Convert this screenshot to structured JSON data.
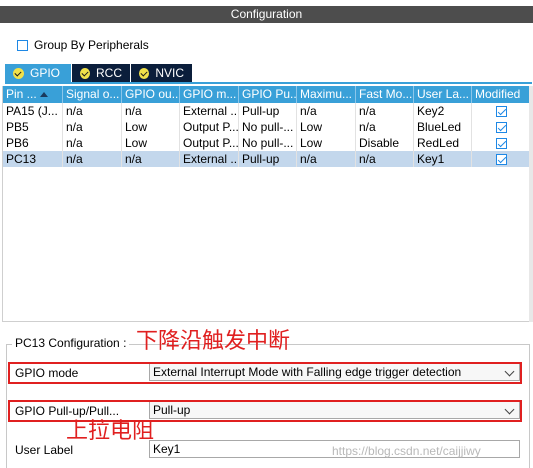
{
  "panel": {
    "title": "Configuration"
  },
  "group_by": {
    "label": "Group By Peripherals",
    "checked": false
  },
  "tabs": [
    {
      "label": "GPIO",
      "active": true
    },
    {
      "label": "RCC",
      "active": false
    },
    {
      "label": "NVIC",
      "active": false
    }
  ],
  "table": {
    "headers": [
      "Pin ...",
      "Signal o...",
      "GPIO ou...",
      "GPIO m...",
      "GPIO Pu...",
      "Maximu...",
      "Fast Mo...",
      "User La...",
      "Modified"
    ],
    "rows": [
      {
        "cells": [
          "PA15 (J...",
          "n/a",
          "n/a",
          "External ...",
          "Pull-up",
          "n/a",
          "n/a",
          "Key2"
        ],
        "modified": true,
        "selected": false
      },
      {
        "cells": [
          "PB5",
          "n/a",
          "Low",
          "Output P...",
          "No pull-...",
          "Low",
          "n/a",
          "BlueLed"
        ],
        "modified": true,
        "selected": false
      },
      {
        "cells": [
          "PB6",
          "n/a",
          "Low",
          "Output P...",
          "No pull-...",
          "Low",
          "Disable",
          "RedLed"
        ],
        "modified": true,
        "selected": false
      },
      {
        "cells": [
          "PC13",
          "n/a",
          "n/a",
          "External ...",
          "Pull-up",
          "n/a",
          "n/a",
          "Key1"
        ],
        "modified": true,
        "selected": true
      }
    ]
  },
  "config": {
    "title": "PC13 Configuration :",
    "gpio_mode": {
      "label": "GPIO mode",
      "value": "External Interrupt Mode with Falling edge trigger detection"
    },
    "pull": {
      "label": "GPIO Pull-up/Pull...",
      "value": "Pull-up"
    },
    "user_label": {
      "label": "User Label",
      "value": "Key1"
    }
  },
  "annotations": {
    "falling_edge": "下降沿触发中断",
    "pull_up": "上拉电阻",
    "color": "#e02020"
  },
  "watermark": "https://blog.csdn.net/caijjiwy"
}
